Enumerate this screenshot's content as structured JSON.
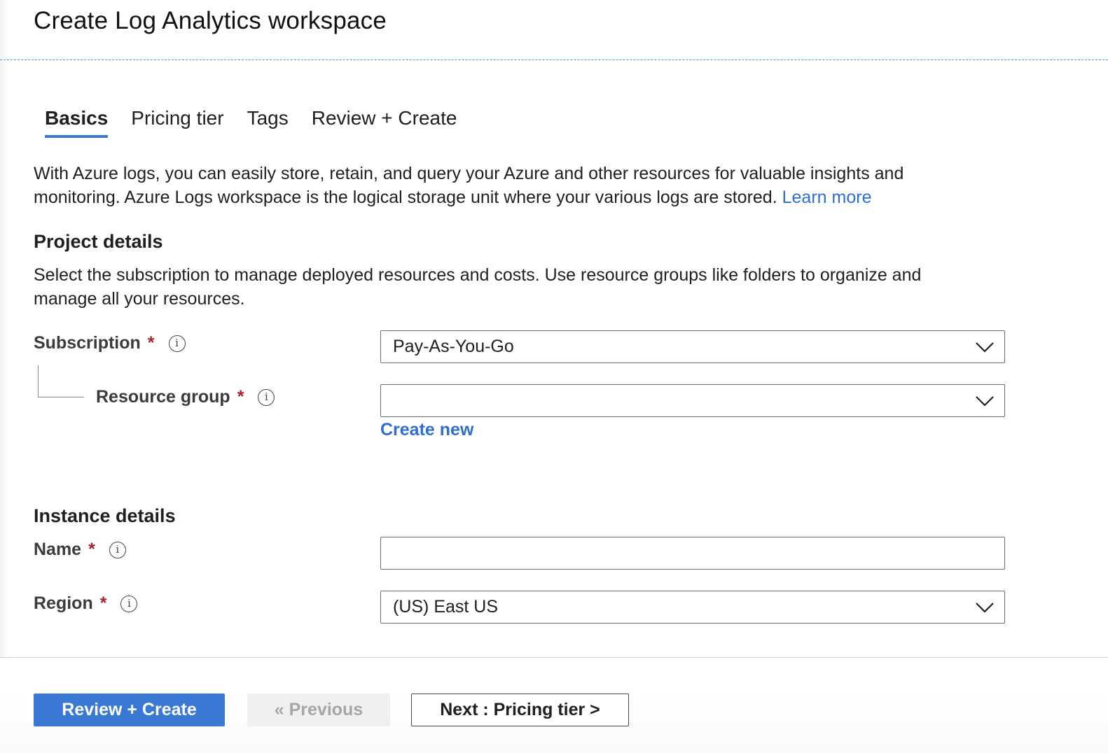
{
  "header": {
    "title": "Create Log Analytics workspace"
  },
  "tabs": [
    {
      "label": "Basics",
      "active": true
    },
    {
      "label": "Pricing tier",
      "active": false
    },
    {
      "label": "Tags",
      "active": false
    },
    {
      "label": "Review + Create",
      "active": false
    }
  ],
  "intro": {
    "text": "With Azure logs, you can easily store, retain, and query your Azure and other resources for valuable insights and monitoring. Azure Logs workspace is the logical storage unit where your various logs are stored.",
    "link": "Learn more"
  },
  "project_details": {
    "heading": "Project details",
    "description": "Select the subscription to manage deployed resources and costs. Use resource groups like folders to organize and manage all your resources.",
    "subscription": {
      "label": "Subscription",
      "required_mark": "*",
      "value": "Pay-As-You-Go"
    },
    "resource_group": {
      "label": "Resource group",
      "required_mark": "*",
      "value": "",
      "create_new": "Create new"
    }
  },
  "instance_details": {
    "heading": "Instance details",
    "name": {
      "label": "Name",
      "required_mark": "*",
      "value": ""
    },
    "region": {
      "label": "Region",
      "required_mark": "*",
      "value": "(US) East US"
    }
  },
  "footer": {
    "review_create": "Review + Create",
    "previous": "« Previous",
    "next": "Next : Pricing tier >"
  },
  "icons": {
    "info": "info-icon",
    "dropdown": "chevron-down-icon"
  },
  "colors": {
    "accent": "#3a78d6",
    "link": "#2e6fd1",
    "required": "#a4262c",
    "divider": "#4aa3d8"
  }
}
